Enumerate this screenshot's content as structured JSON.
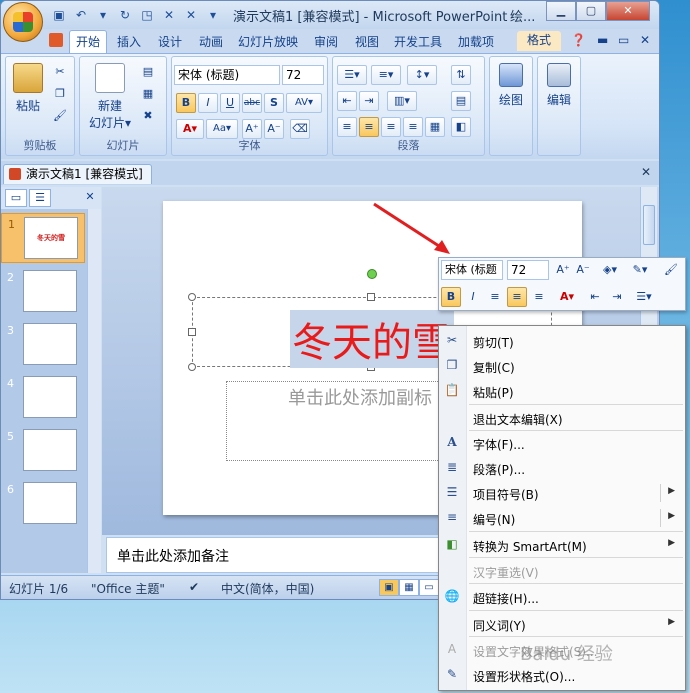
{
  "window": {
    "title": "演示文稿1 [兼容模式] - Microsoft PowerPoint",
    "title_extra": "绘..."
  },
  "tabs": [
    "开始",
    "插入",
    "设计",
    "动画",
    "幻灯片放映",
    "审阅",
    "视图",
    "开发工具",
    "加载项",
    "格式"
  ],
  "ribbon": {
    "clipboard": {
      "label": "剪贴板",
      "paste": "粘贴"
    },
    "slides": {
      "label": "幻灯片",
      "new_slide": "新建",
      "new_slide2": "幻灯片▾"
    },
    "font": {
      "label": "字体",
      "font_name": "宋体 (标题)",
      "font_size": "72"
    },
    "paragraph": {
      "label": "段落"
    },
    "drawing": {
      "label": "绘图"
    },
    "editing": {
      "label": "编辑"
    }
  },
  "document_tab": "演示文稿1 [兼容模式]",
  "slides_panel": {
    "numbers": [
      "1",
      "2",
      "3",
      "4",
      "5",
      "6"
    ],
    "thumb_title": "冬天的雪"
  },
  "slide": {
    "title_text": "冬天的雪",
    "subtitle_placeholder": "单击此处添加副标"
  },
  "notes": {
    "placeholder": "单击此处添加备注"
  },
  "status": {
    "slide_count": "幻灯片 1/6",
    "theme": "\"Office 主题\"",
    "language": "中文(简体，中国)"
  },
  "mini_toolbar": {
    "font_name": "宋体 (标题",
    "font_size": "72"
  },
  "context_menu": {
    "cut": "剪切(T)",
    "copy": "复制(C)",
    "paste": "粘贴(P)",
    "exit_edit": "退出文本编辑(X)",
    "font": "字体(F)...",
    "paragraph": "段落(P)...",
    "bullets": "项目符号(B)",
    "numbering": "编号(N)",
    "smartart": "转换为 SmartArt(M)",
    "hanzi": "汉字重选(V)",
    "hyperlink": "超链接(H)...",
    "synonyms": "同义词(Y)",
    "text_effects": "设置文字效果格式(S)...",
    "shape_format": "设置形状格式(O)..."
  },
  "watermark": "Baidu 经验",
  "colors": {
    "accent": "#15428b",
    "title_red": "#e81a1a",
    "highlight": "#f9c85d"
  }
}
